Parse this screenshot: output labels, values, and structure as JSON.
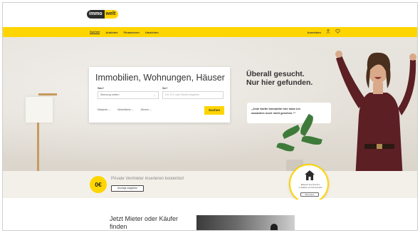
{
  "brand": {
    "part1": "immo",
    "part2": "welt",
    "color_accent": "#ffd500"
  },
  "nav": {
    "links": [
      "Suchen",
      "Anbieten",
      "Finanzieren",
      "Umziehen"
    ],
    "active": "Suchen",
    "right_label": "Anmelden",
    "icons": [
      "user-icon",
      "heart-icon"
    ]
  },
  "search": {
    "title": "Immobilien, Wohnungen, Häuser",
    "was_label": "Was?",
    "wo_label": "Wo?",
    "was_value": "Wohnung mieten",
    "wo_placeholder": "Ort, PLZ oder Straße eingeben",
    "filters": [
      "Mietpreis",
      "Wohnfläche",
      "Zimmer"
    ],
    "button": "Suchen"
  },
  "hero": {
    "headline_line1": "Überall gesucht.",
    "headline_line2": "Nur hier gefunden.",
    "quote_line1": "„Jede fünfte Immobilie hier habe ich",
    "quote_line2": "woanders noch nicht gesehen.“*"
  },
  "band": {
    "coin": "0€",
    "text": "Private Vermieter inserieren kostenlos!",
    "button": "Anzeige aufgeben"
  },
  "badge": {
    "line1": "Bekannt aus Quizzen",
    "line2": "in Städten und Gemeinden",
    "button": "Ihre Immo"
  },
  "lower": {
    "line1": "Jetzt Mieter oder Käufer",
    "line2": "finden"
  }
}
